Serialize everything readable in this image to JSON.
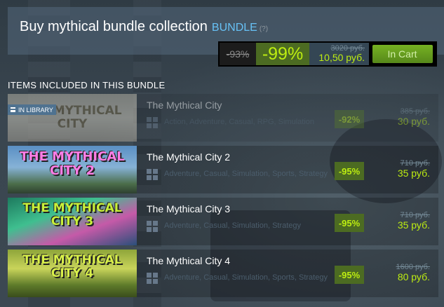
{
  "header": {
    "title": "Buy mythical bundle collection",
    "bundle_label": "BUNDLE",
    "help": "(?)"
  },
  "purchase": {
    "original_discount": "-93%",
    "discount": "-99%",
    "original_price": "3020 руб.",
    "final_price": "10,50 руб.",
    "button": "In Cart"
  },
  "section_title": "ITEMS INCLUDED IN THIS BUNDLE",
  "items": [
    {
      "name": "The Mythical City",
      "capsule_text": "THE MYTHICAL CITY",
      "tags": "Action, Adventure, Casual, RPG, Simulation",
      "discount": "-92%",
      "original_price": "385 руб.",
      "final_price": "30 руб.",
      "in_library": "IN LIBRARY"
    },
    {
      "name": "The Mythical City 2",
      "capsule_text": "THE MYTHICAL CITY 2",
      "tags": "Adventure, Casual, Simulation, Sports, Strategy",
      "discount": "-95%",
      "original_price": "710 руб.",
      "final_price": "35 руб."
    },
    {
      "name": "The Mythical City 3",
      "capsule_text": "THE MYTHICAL CITY 3",
      "tags": "Adventure, Casual, Simulation, Strategy",
      "discount": "-95%",
      "original_price": "710 руб.",
      "final_price": "35 руб."
    },
    {
      "name": "The Mythical City 4",
      "capsule_text": "THE MYTHICAL CITY 4",
      "tags": "Adventure, Casual, Simulation, Sports, Strategy",
      "discount": "-95%",
      "original_price": "1600 руб.",
      "final_price": "80 руб."
    }
  ],
  "colors": {
    "accent_green": "#beee11",
    "discount_bg": "#4c6b22",
    "link_blue": "#67c1f5",
    "cart_button": "#75b022"
  },
  "icons": {
    "platform": "windows-icon",
    "library": "library-icon"
  }
}
